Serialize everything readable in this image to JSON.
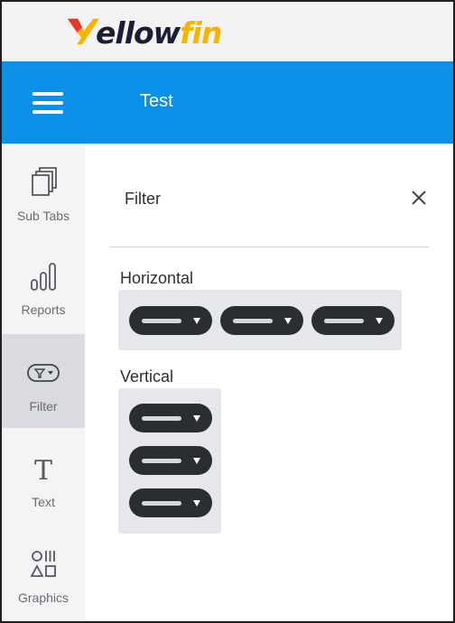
{
  "brand": {
    "logo_text_a": "ellow",
    "logo_text_b": "fin",
    "accent_color": "#0a90e6",
    "logo_color": "#f5b400"
  },
  "header": {
    "title": "Test",
    "menu_icon": "hamburger-icon"
  },
  "sidebar": {
    "items": [
      {
        "label": "Sub Tabs",
        "icon": "sub-tabs-icon",
        "active": false
      },
      {
        "label": "Reports",
        "icon": "reports-icon",
        "active": false
      },
      {
        "label": "Filter",
        "icon": "filter-icon",
        "active": true
      },
      {
        "label": "Text",
        "icon": "text-icon",
        "active": false
      },
      {
        "label": "Graphics",
        "icon": "graphics-icon",
        "active": false
      }
    ]
  },
  "panel": {
    "title": "Filter",
    "close_icon": "close-icon",
    "sections": [
      {
        "label": "Horizontal",
        "layout": "horizontal",
        "pill_count": 3
      },
      {
        "label": "Vertical",
        "layout": "vertical",
        "pill_count": 3
      }
    ]
  }
}
